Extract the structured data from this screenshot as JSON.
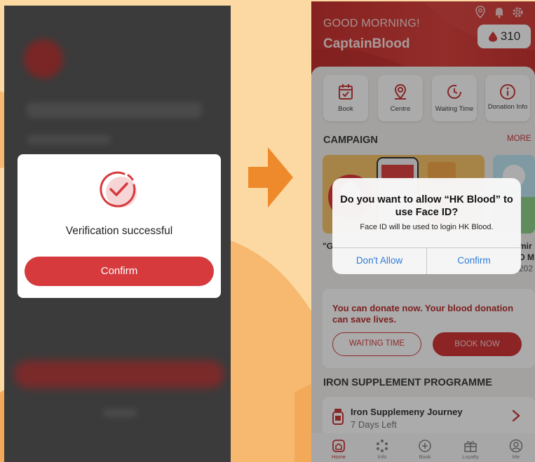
{
  "colors": {
    "background": "#fcd9a3",
    "accent_red": "#d63a3d",
    "arrow_orange": "#ee8a2c",
    "ios_blue": "#2f7bd9"
  },
  "left_screen": {
    "dialog": {
      "icon": "check-circle-icon",
      "message": "Verification successful",
      "confirm_label": "Confirm"
    }
  },
  "transition": {
    "icon": "arrow-right-icon"
  },
  "right_screen": {
    "header": {
      "greeting": "GOOD MORNING!",
      "username": "CaptainBlood",
      "points": "310",
      "icons": [
        "location-pin-icon",
        "bell-icon",
        "gear-icon"
      ]
    },
    "quick_actions": [
      {
        "label": "Book",
        "icon": "calendar-check-icon"
      },
      {
        "label": "Centre",
        "icon": "location-pin-icon"
      },
      {
        "label": "Waiting Time",
        "icon": "clock-icon"
      },
      {
        "label": "Donation Info",
        "icon": "info-icon"
      }
    ],
    "campaign": {
      "title": "CAMPAIGN",
      "more_label": "MORE",
      "partial_text_left": "\"G",
      "partial_text_right_1": "mir",
      "partial_text_right_2": "D M",
      "partial_text_right_3": "202"
    },
    "donate_card": {
      "text": "You can donate now. Your blood donation can save lives.",
      "waiting_time_label": "WAITING TIME",
      "book_now_label": "BOOK NOW"
    },
    "iron": {
      "title": "IRON SUPPLEMENT PROGRAMME",
      "card_title": "Iron Supplemeny Journey",
      "card_subtitle": "7 Days Left"
    },
    "tabbar": [
      {
        "label": "Home",
        "icon": "home-icon"
      },
      {
        "label": "Info",
        "icon": "dots-icon"
      },
      {
        "label": "Book",
        "icon": "plus-circle-icon"
      },
      {
        "label": "Loyalty",
        "icon": "gift-icon"
      },
      {
        "label": "Me",
        "icon": "user-icon"
      }
    ],
    "alert": {
      "title": "Do you want to allow “HK Blood” to use Face ID?",
      "message": "Face ID will be used to login HK Blood.",
      "deny_label": "Don't Allow",
      "confirm_label": "Confirm"
    }
  }
}
